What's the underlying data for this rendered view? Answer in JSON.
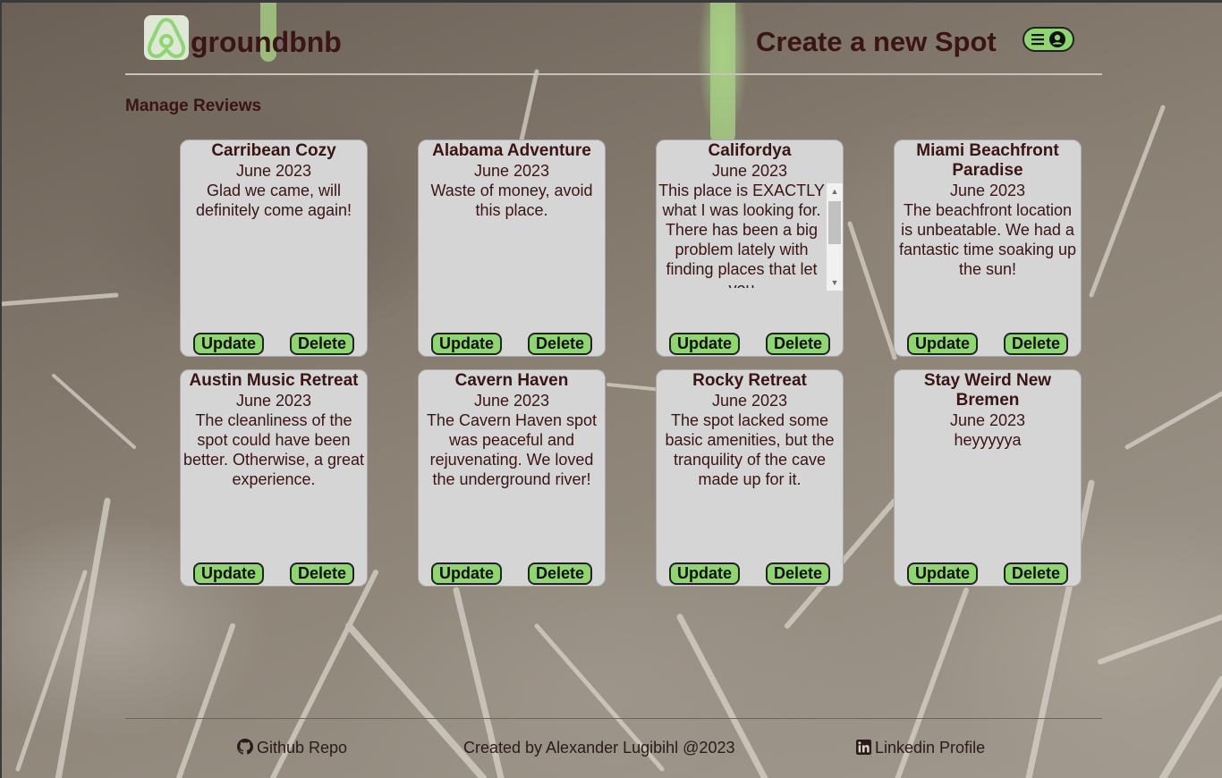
{
  "header": {
    "brand": "groundbnb",
    "create_link": "Create a new Spot",
    "logo_icon": "airbnb-logo-icon",
    "menu_icons": [
      "hamburger-icon",
      "user-circle-icon"
    ],
    "accent_color": "#8fd672"
  },
  "page": {
    "title": "Manage Reviews"
  },
  "reviews": [
    {
      "spot": "Carribean Cozy",
      "date": "June 2023",
      "text": "Glad we came, will definitely come again!",
      "update": "Update",
      "delete": "Delete"
    },
    {
      "spot": "Alabama Adventure",
      "date": "June 2023",
      "text": "Waste of money, avoid this place.",
      "update": "Update",
      "delete": "Delete"
    },
    {
      "spot": "Califordya",
      "date": "June 2023",
      "text": "This place is EXACTLY what I was looking for. There has been a big problem lately with finding places that let you",
      "update": "Update",
      "delete": "Delete"
    },
    {
      "spot": "Miami Beachfront Paradise",
      "date": "June 2023",
      "text": "The beachfront location is unbeatable. We had a fantastic time soaking up the sun!",
      "update": "Update",
      "delete": "Delete"
    },
    {
      "spot": "Austin Music Retreat",
      "date": "June 2023",
      "text": "The cleanliness of the spot could have been better. Otherwise, a great experience.",
      "update": "Update",
      "delete": "Delete"
    },
    {
      "spot": "Cavern Haven",
      "date": "June 2023",
      "text": "The Cavern Haven spot was peaceful and rejuvenating. We loved the underground river!",
      "update": "Update",
      "delete": "Delete"
    },
    {
      "spot": "Rocky Retreat",
      "date": "June 2023",
      "text": "The spot lacked some basic amenities, but the tranquility of the cave made up for it.",
      "update": "Update",
      "delete": "Delete"
    },
    {
      "spot": "Stay Weird New Bremen",
      "date": "June 2023",
      "text": "heyyyyya",
      "update": "Update",
      "delete": "Delete"
    }
  ],
  "footer": {
    "github": "Github Repo",
    "credit": "Created by Alexander Lugibihl @2023",
    "linkedin": "Linkedin Profile",
    "github_icon": "github-icon",
    "linkedin_icon": "linkedin-icon"
  }
}
